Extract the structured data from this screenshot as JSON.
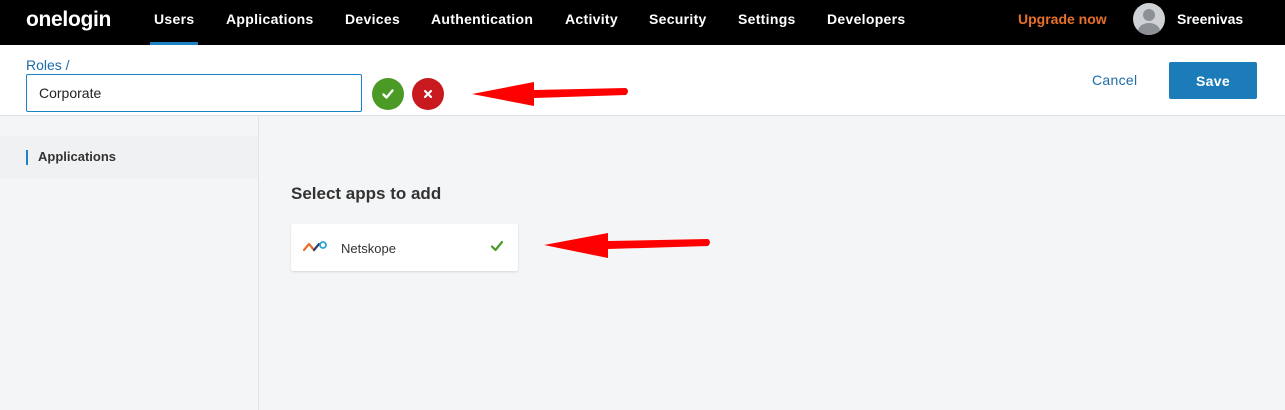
{
  "nav": {
    "logo": "onelogin",
    "items": [
      {
        "label": "Users",
        "active": true
      },
      {
        "label": "Applications",
        "active": false
      },
      {
        "label": "Devices",
        "active": false
      },
      {
        "label": "Authentication",
        "active": false
      },
      {
        "label": "Activity",
        "active": false
      },
      {
        "label": "Security",
        "active": false
      },
      {
        "label": "Settings",
        "active": false
      },
      {
        "label": "Developers",
        "active": false
      }
    ],
    "upgrade": "Upgrade now",
    "username": "Sreenivas"
  },
  "header": {
    "breadcrumb": "Roles /",
    "role_name": "Corporate",
    "cancel_label": "Cancel",
    "save_label": "Save"
  },
  "sidebar": {
    "items": [
      {
        "label": "Applications",
        "active": true
      }
    ]
  },
  "main": {
    "section_title": "Select apps to add",
    "apps": [
      {
        "name": "Netskope",
        "selected": true
      }
    ]
  },
  "colors": {
    "nav_bg": "#000000",
    "accent": "#1c82c4",
    "upgrade": "#e8702a",
    "confirm": "#4a9a25",
    "cancel": "#c8191f",
    "annotation_arrow": "#ff0000"
  }
}
